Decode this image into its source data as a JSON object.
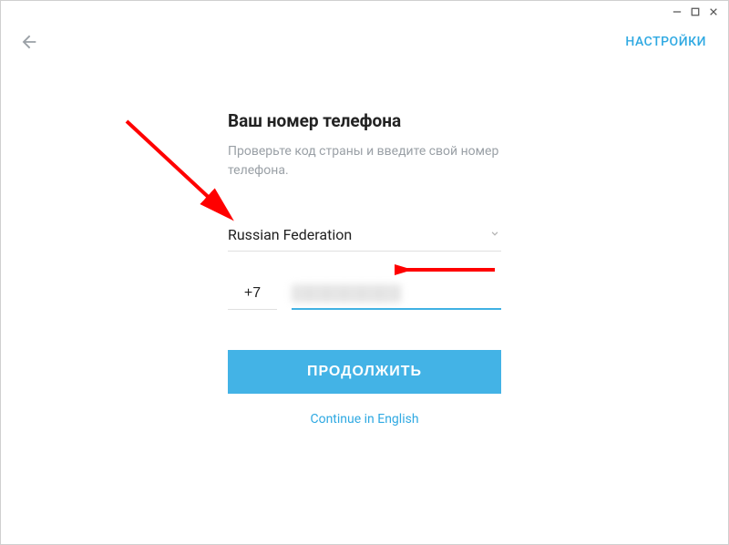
{
  "window": {
    "minimize": "—",
    "maximize": "❐",
    "close": "✕"
  },
  "topbar": {
    "settings_label": "НАСТРОЙКИ"
  },
  "form": {
    "title": "Ваш номер телефона",
    "subtitle": "Проверьте код страны и введите свой номер телефона.",
    "country": "Russian Federation",
    "dial_code": "+7",
    "phone_value": "",
    "continue_label": "ПРОДОЛЖИТЬ",
    "lang_switch": "Continue in English"
  },
  "colors": {
    "accent": "#43b3e6",
    "link": "#2fa9e2",
    "annotation": "#ff0000"
  }
}
